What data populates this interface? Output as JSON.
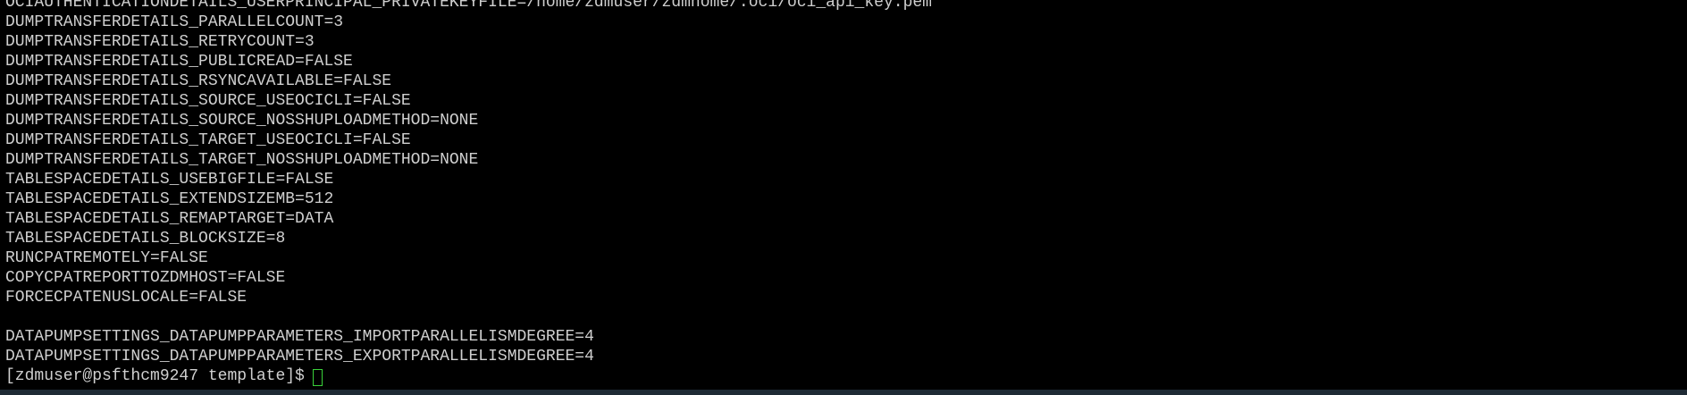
{
  "terminal": {
    "lines": [
      "OCIAUTHENTICATIONDETAILS_USERPRINCIPAL_PRIVATEKEYFILE=/home/zdmuser/zdmhome/.oci/oci_api_key.pem",
      "DUMPTRANSFERDETAILS_PARALLELCOUNT=3",
      "DUMPTRANSFERDETAILS_RETRYCOUNT=3",
      "DUMPTRANSFERDETAILS_PUBLICREAD=FALSE",
      "DUMPTRANSFERDETAILS_RSYNCAVAILABLE=FALSE",
      "DUMPTRANSFERDETAILS_SOURCE_USEOCICLI=FALSE",
      "DUMPTRANSFERDETAILS_SOURCE_NOSSHUPLOADMETHOD=NONE",
      "DUMPTRANSFERDETAILS_TARGET_USEOCICLI=FALSE",
      "DUMPTRANSFERDETAILS_TARGET_NOSSHUPLOADMETHOD=NONE",
      "TABLESPACEDETAILS_USEBIGFILE=FALSE",
      "TABLESPACEDETAILS_EXTENDSIZEMB=512",
      "TABLESPACEDETAILS_REMAPTARGET=DATA",
      "TABLESPACEDETAILS_BLOCKSIZE=8",
      "RUNCPATREMOTELY=FALSE",
      "COPYCPATREPORTTOZDMHOST=FALSE",
      "FORCECPATENUSLOCALE=FALSE",
      "",
      "DATAPUMPSETTINGS_DATAPUMPPARAMETERS_IMPORTPARALLELISMDEGREE=4",
      "DATAPUMPSETTINGS_DATAPUMPPARAMETERS_EXPORTPARALLELISMDEGREE=4"
    ],
    "prompt": "[zdmuser@psfthcm9247 template]$",
    "text_color": "#cfcfcf",
    "background_color": "#000000",
    "cursor_color": "#3ad13a"
  }
}
